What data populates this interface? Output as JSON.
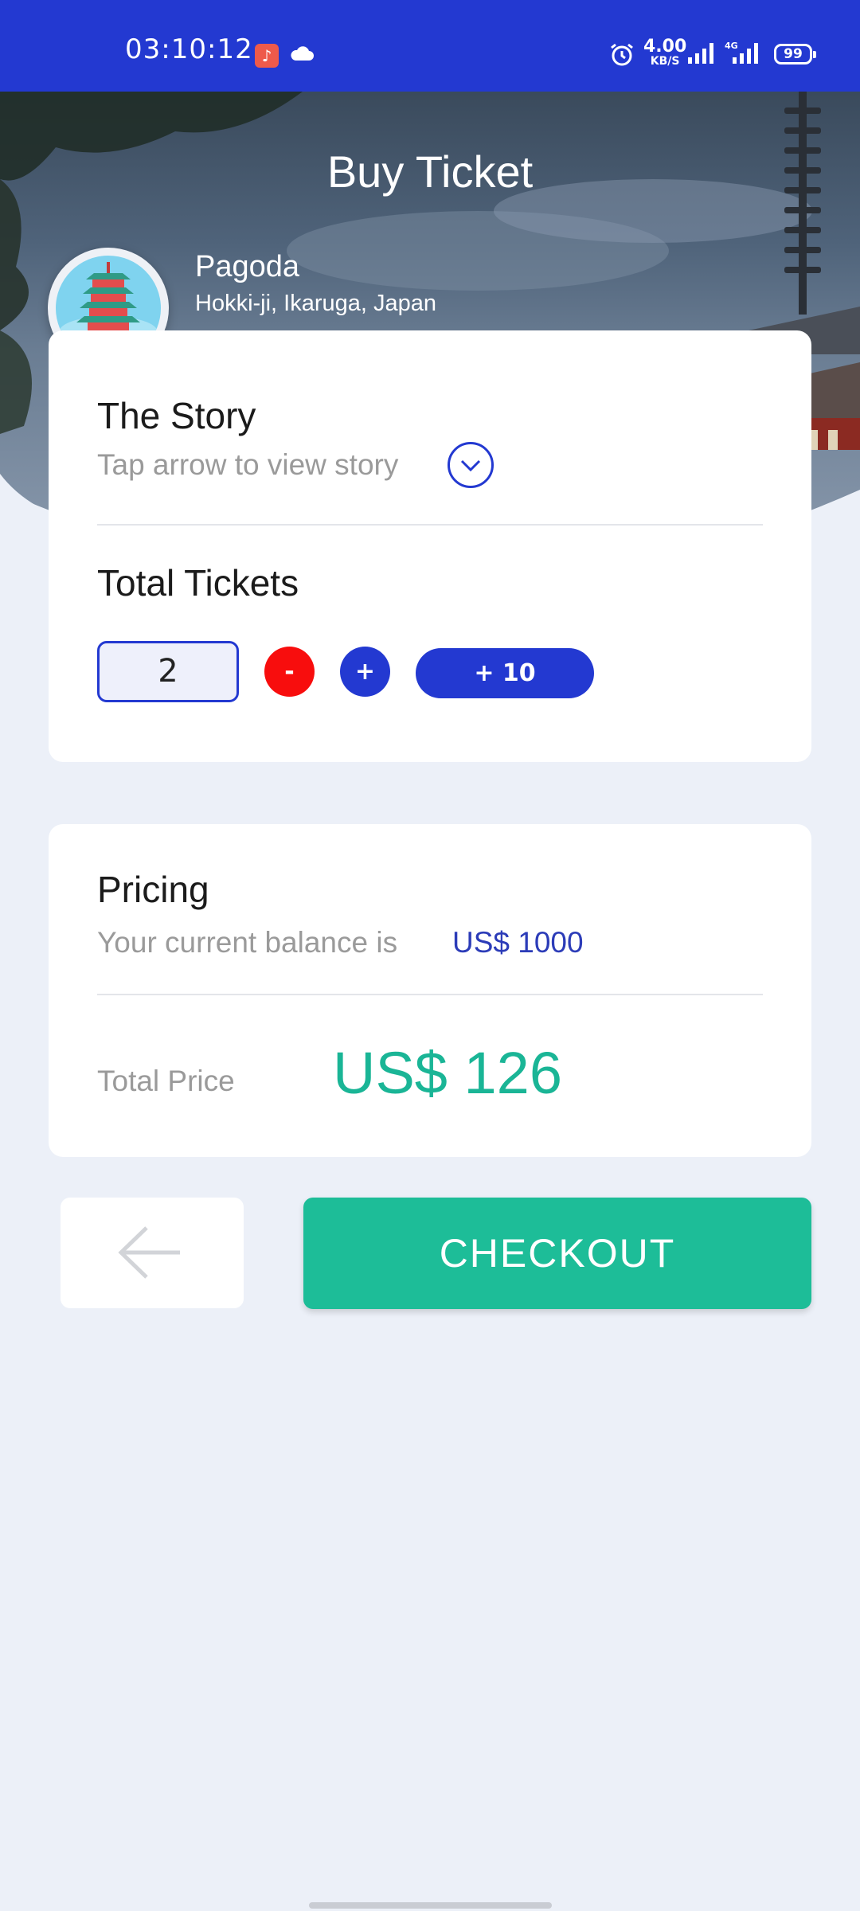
{
  "status_bar": {
    "time": "03:10:12",
    "net_speed_value": "4.00",
    "net_speed_unit": "KB/S",
    "battery": "99",
    "icons": [
      "music-icon",
      "cloud-icon",
      "alarm-icon",
      "signal-icon",
      "signal-4g-icon",
      "battery-icon"
    ]
  },
  "header": {
    "title": "Buy Ticket"
  },
  "place": {
    "name": "Pagoda",
    "location": "Hokki-ji, Ikaruga, Japan"
  },
  "story": {
    "title": "The Story",
    "hint": "Tap arrow to view story"
  },
  "tickets": {
    "title": "Total Tickets",
    "quantity": "2",
    "minus_label": "-",
    "plus_label": "+",
    "plus_ten_label": "+ 10"
  },
  "pricing": {
    "title": "Pricing",
    "balance_label": "Your current balance is",
    "balance_value": "US$ 1000",
    "total_label": "Total Price",
    "total_value": "US$ 126"
  },
  "actions": {
    "checkout_label": "CHECKOUT"
  },
  "colors": {
    "primary": "#2339d1",
    "accent": "#1dbd98",
    "danger": "#f80d0d",
    "background": "#ecf0f8"
  }
}
